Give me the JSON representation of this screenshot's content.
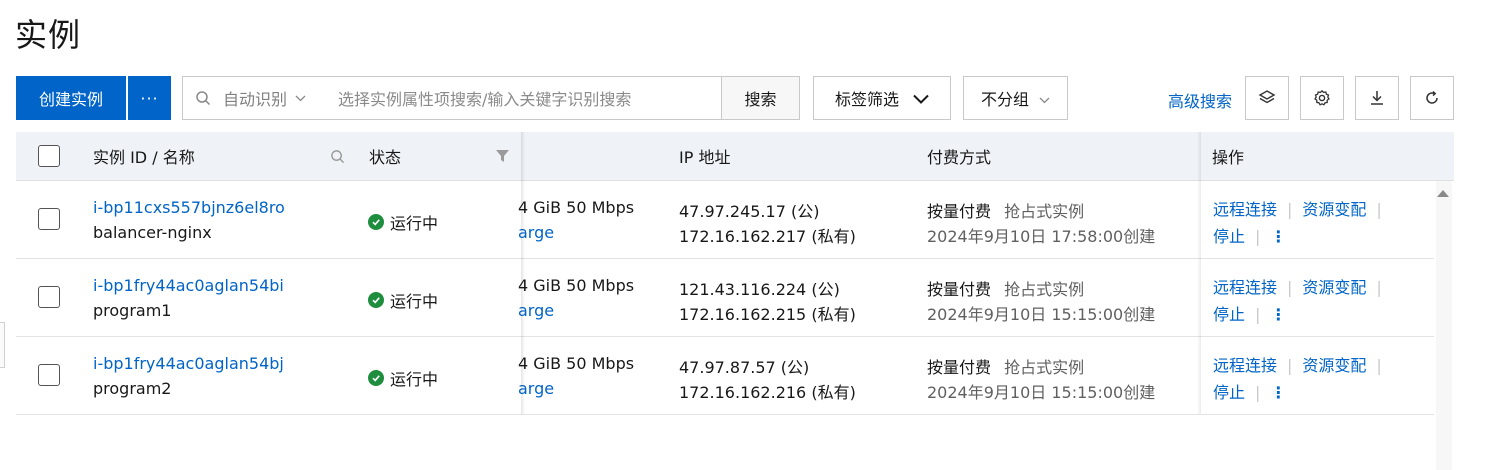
{
  "page": {
    "title": "实例"
  },
  "toolbar": {
    "create_label": "创建实例",
    "more_label": "···",
    "search_prefix": "自动识别",
    "search_placeholder": "选择实例属性项搜索/输入关键字识别搜索",
    "search_button": "搜索",
    "tag_filter_label": "标签筛选",
    "group_label": "不分组",
    "advanced_search": "高级搜索",
    "icons": [
      "layers-icon",
      "gear-icon",
      "download-icon",
      "refresh-icon"
    ]
  },
  "table": {
    "columns": {
      "instance": "实例 ID / 名称",
      "status": "状态",
      "ip": "IP 地址",
      "payment": "付费方式",
      "actions": "操作"
    },
    "rows": [
      {
        "id": "i-bp11cxs557bjnz6el8ro",
        "name": "balancer-nginx",
        "status": "运行中",
        "spec_line1": "4 GiB 50 Mbps",
        "spec_line2": "arge",
        "ip_public": "47.97.245.17 (公)",
        "ip_private": "172.16.162.217 (私有)",
        "pay_type": "按量付费",
        "pay_extra": "抢占式实例",
        "created": "2024年9月10日 17:58:00创建",
        "op_connect": "远程连接",
        "op_resize": "资源变配",
        "op_stop": "停止"
      },
      {
        "id": "i-bp1fry44ac0aglan54bi",
        "name": "program1",
        "status": "运行中",
        "spec_line1": "4 GiB 50 Mbps",
        "spec_line2": "arge",
        "ip_public": "121.43.116.224 (公)",
        "ip_private": "172.16.162.215 (私有)",
        "pay_type": "按量付费",
        "pay_extra": "抢占式实例",
        "created": "2024年9月10日 15:15:00创建",
        "op_connect": "远程连接",
        "op_resize": "资源变配",
        "op_stop": "停止"
      },
      {
        "id": "i-bp1fry44ac0aglan54bj",
        "name": "program2",
        "status": "运行中",
        "spec_line1": "4 GiB 50 Mbps",
        "spec_line2": "arge",
        "ip_public": "47.97.87.57 (公)",
        "ip_private": "172.16.162.216 (私有)",
        "pay_type": "按量付费",
        "pay_extra": "抢占式实例",
        "created": "2024年9月10日 15:15:00创建",
        "op_connect": "远程连接",
        "op_resize": "资源变配",
        "op_stop": "停止"
      }
    ]
  },
  "colors": {
    "accent": "#0064c8",
    "running": "#1e8e3e",
    "header_bg": "#eff3f8"
  }
}
